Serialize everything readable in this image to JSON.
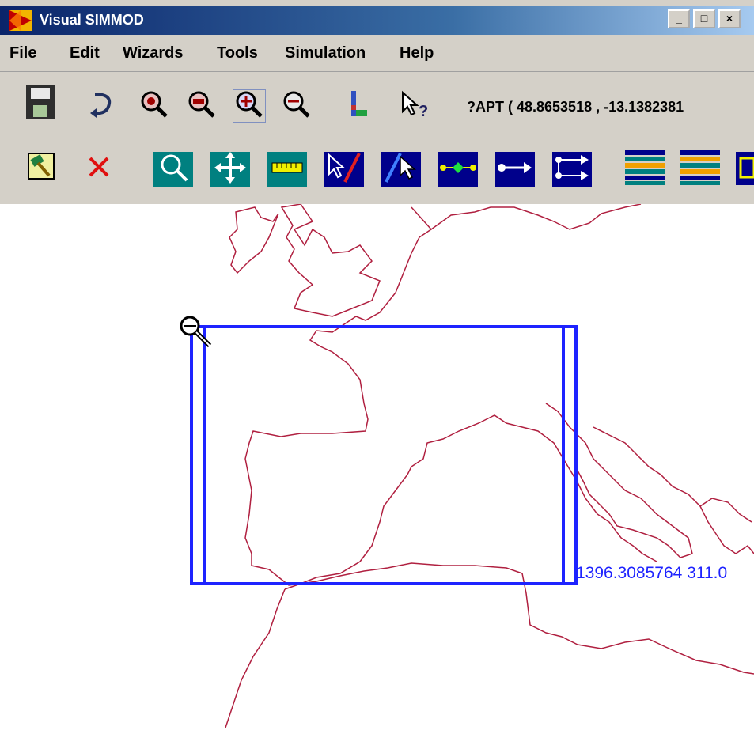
{
  "window": {
    "title": "Visual SIMMOD",
    "minimize": "_",
    "maximize": "□",
    "close": "×"
  },
  "menu": [
    {
      "label": "File"
    },
    {
      "label": "Edit"
    },
    {
      "label": "Wizards"
    },
    {
      "label": "Tools"
    },
    {
      "label": "Simulation"
    },
    {
      "label": "Help"
    }
  ],
  "toolbar1": {
    "icons": [
      "save-icon",
      "undo-icon",
      "zoom-in-icon",
      "zoom-out-icon",
      "zoom-box-icon",
      "zoom-minus-icon",
      "layers-icon",
      "whats-this-icon"
    ],
    "apt_readout": "?APT ( 48.8653518 , -13.1382381"
  },
  "toolbar2": {
    "icons": [
      "edit-hammer-icon",
      "delete-x-icon",
      "zoom-lens-icon",
      "pan-icon",
      "ruler-icon",
      "draw-line-icon",
      "select-link-icon",
      "node-link-icon",
      "arrow-link-icon",
      "route-icon",
      "runway-lines-icon",
      "runway-lines-2-icon",
      "grid-icon"
    ]
  },
  "map": {
    "coord_readout": "1396.3085764 311.0",
    "colors": {
      "coastline": "#b02040",
      "selection": "#1e23ff"
    }
  }
}
